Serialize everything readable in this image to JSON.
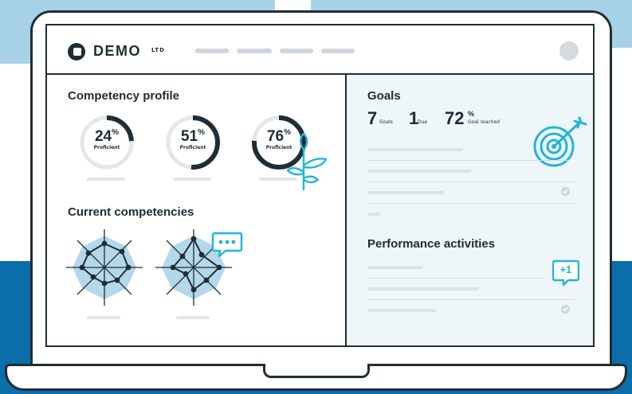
{
  "colors": {
    "accent": "#22b5d6",
    "dark": "#1f2d35",
    "light_blue": "#a7d1e6",
    "brand_blue": "#0b6ea8",
    "panel_bg": "#eef6f9"
  },
  "header": {
    "logo_text": "DEMO",
    "logo_suffix": "LTD",
    "nav_placeholder_count": 4
  },
  "competency_profile": {
    "title": "Competency profile",
    "gauges": [
      {
        "value": "24",
        "unit": "%",
        "label": "Proficient",
        "fraction": 0.24
      },
      {
        "value": "51",
        "unit": "%",
        "label": "Proficient",
        "fraction": 0.51
      },
      {
        "value": "76",
        "unit": "%",
        "label": "Proficient",
        "fraction": 0.76
      }
    ]
  },
  "current_competencies": {
    "title": "Current competencies"
  },
  "goals": {
    "title": "Goals",
    "stats": [
      {
        "value": "7",
        "label": "Goals"
      },
      {
        "value": "1",
        "label": "Due"
      },
      {
        "value": "72",
        "unit": "%",
        "label": "Goal reached"
      }
    ]
  },
  "performance_activities": {
    "title": "Performance activities",
    "badge": "+1"
  },
  "icons": {
    "target": "target-icon",
    "chat": "chat-bubble-icon",
    "plant": "plant-sprout-icon",
    "check": "check-circle-icon",
    "plus_one": "plus-one-badge-icon"
  }
}
